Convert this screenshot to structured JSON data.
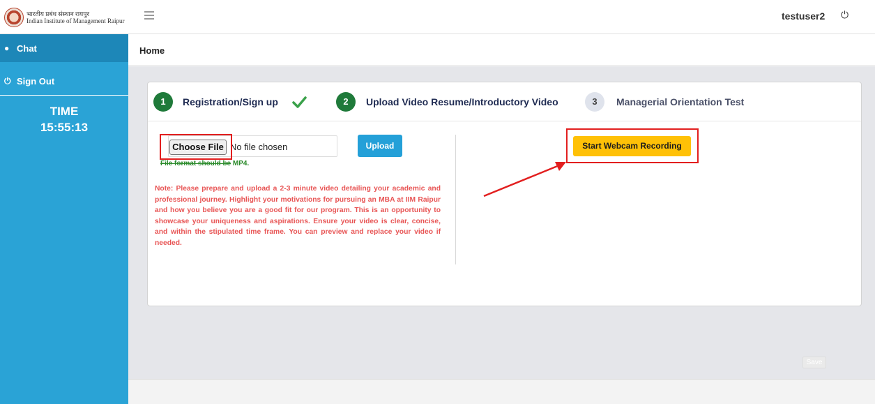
{
  "header": {
    "logo_hindi": "भारतीय प्रबंध संस्थान रायपुर",
    "logo_english": "Indian Institute of Management Raipur",
    "username": "testuser2",
    "power_icon": "power-icon",
    "menu_icon": "hamburger-icon"
  },
  "sidebar": {
    "items": [
      {
        "label": "Chat",
        "icon": "chat-bubble-icon"
      },
      {
        "label": "Sign Out",
        "icon": "power-icon"
      }
    ],
    "time_label": "TIME",
    "time_value": "15:55:13"
  },
  "breadcrumb": {
    "current": "Home"
  },
  "steps": [
    {
      "number": "1",
      "label": "Registration/Sign up",
      "status": "done"
    },
    {
      "number": "2",
      "label": "Upload Video Resume/Introductory Video",
      "status": "active"
    },
    {
      "number": "3",
      "label": "Managerial Orientation Test",
      "status": "pending"
    }
  ],
  "upload": {
    "choose_label": "Choose File",
    "no_file_text": "No file chosen",
    "format_note_struck": "File format should be",
    "format_note_rest": " MP4.",
    "upload_label": "Upload",
    "note": "Note: Please prepare and upload a 2-3 minute video detailing your academic and professional journey. Highlight your motivations for pursuing an MBA at IIM Raipur and how you believe you are a good fit for our program. This is an opportunity to showcase your uniqueness and aspirations. Ensure your video is clear, concise, and within the stipulated time frame. You can preview and replace your video if needed."
  },
  "webcam": {
    "label": "Start Webcam Recording"
  },
  "footer": {
    "save_label": "Save"
  },
  "colors": {
    "sidebar": "#2aa3d6",
    "step_done": "#1f7a3a",
    "webcam_button": "#ffc107",
    "upload_button": "#24a0d8",
    "annotation": "#e21f1f",
    "note_text": "#e85555"
  }
}
